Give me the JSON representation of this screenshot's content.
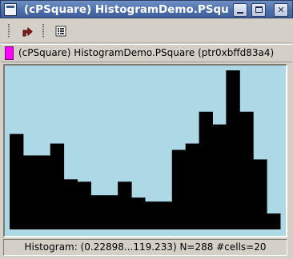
{
  "window": {
    "title": "(cPSquare) HistogramDemo.PSquare"
  },
  "toolbar": {
    "tools": [
      {
        "name": "back-arrow-icon"
      },
      {
        "name": "list-icon"
      }
    ]
  },
  "info": {
    "object_label": "(cPSquare) HistogramDemo.PSquare  (ptr0xbffd83a4)",
    "swatch_color": "#ff00ff"
  },
  "status": {
    "text": "Histogram: (0.22898...119.233)  N=288  #cells=20"
  },
  "chart_data": {
    "type": "bar",
    "x_range": [
      0.22898,
      119.233
    ],
    "n": 288,
    "cells": 20,
    "bar_color": "#000000",
    "background": "#add8e6",
    "values": [
      120,
      93,
      93,
      108,
      63,
      60,
      43,
      43,
      60,
      40,
      35,
      35,
      100,
      108,
      148,
      132,
      200,
      148,
      88,
      20
    ]
  }
}
